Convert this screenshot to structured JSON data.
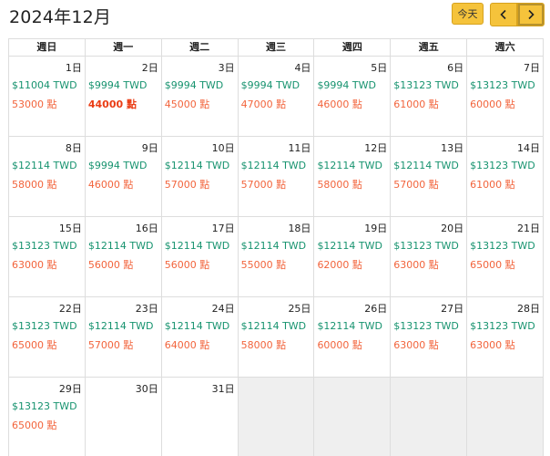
{
  "header": {
    "title": "2024年12月",
    "today_label": "今天"
  },
  "weekdays": [
    "週日",
    "週一",
    "週二",
    "週三",
    "週四",
    "週五",
    "週六"
  ],
  "weeks": [
    [
      {
        "day": "1日",
        "price": "$11004 TWD",
        "points": "53000 點"
      },
      {
        "day": "2日",
        "price": "$9994 TWD",
        "points": "44000 點",
        "highlight": true
      },
      {
        "day": "3日",
        "price": "$9994 TWD",
        "points": "45000 點"
      },
      {
        "day": "4日",
        "price": "$9994 TWD",
        "points": "47000 點"
      },
      {
        "day": "5日",
        "price": "$9994 TWD",
        "points": "46000 點"
      },
      {
        "day": "6日",
        "price": "$13123 TWD",
        "points": "61000 點"
      },
      {
        "day": "7日",
        "price": "$13123 TWD",
        "points": "60000 點"
      }
    ],
    [
      {
        "day": "8日",
        "price": "$12114 TWD",
        "points": "58000 點"
      },
      {
        "day": "9日",
        "price": "$9994 TWD",
        "points": "46000 點"
      },
      {
        "day": "10日",
        "price": "$12114 TWD",
        "points": "57000 點"
      },
      {
        "day": "11日",
        "price": "$12114 TWD",
        "points": "57000 點"
      },
      {
        "day": "12日",
        "price": "$12114 TWD",
        "points": "58000 點"
      },
      {
        "day": "13日",
        "price": "$12114 TWD",
        "points": "57000 點"
      },
      {
        "day": "14日",
        "price": "$13123 TWD",
        "points": "61000 點"
      }
    ],
    [
      {
        "day": "15日",
        "price": "$13123 TWD",
        "points": "63000 點"
      },
      {
        "day": "16日",
        "price": "$12114 TWD",
        "points": "56000 點"
      },
      {
        "day": "17日",
        "price": "$12114 TWD",
        "points": "56000 點"
      },
      {
        "day": "18日",
        "price": "$12114 TWD",
        "points": "55000 點"
      },
      {
        "day": "19日",
        "price": "$12114 TWD",
        "points": "62000 點"
      },
      {
        "day": "20日",
        "price": "$13123 TWD",
        "points": "63000 點"
      },
      {
        "day": "21日",
        "price": "$13123 TWD",
        "points": "65000 點"
      }
    ],
    [
      {
        "day": "22日",
        "price": "$13123 TWD",
        "points": "65000 點"
      },
      {
        "day": "23日",
        "price": "$12114 TWD",
        "points": "57000 點"
      },
      {
        "day": "24日",
        "price": "$12114 TWD",
        "points": "64000 點"
      },
      {
        "day": "25日",
        "price": "$12114 TWD",
        "points": "58000 點"
      },
      {
        "day": "26日",
        "price": "$12114 TWD",
        "points": "60000 點"
      },
      {
        "day": "27日",
        "price": "$13123 TWD",
        "points": "63000 點"
      },
      {
        "day": "28日",
        "price": "$13123 TWD",
        "points": "63000 點"
      }
    ],
    [
      {
        "day": "29日",
        "price": "$13123 TWD",
        "points": "65000 點"
      },
      {
        "day": "30日"
      },
      {
        "day": "31日"
      },
      {
        "empty": true
      },
      {
        "empty": true
      },
      {
        "empty": true
      },
      {
        "empty": true
      }
    ]
  ],
  "colors": {
    "price": "#17936f",
    "points": "#f2643c",
    "points_highlight": "#ea3c14",
    "button": "#f5c33b",
    "empty_cell": "#efefef"
  },
  "icons": {
    "prev": "chevron-left-icon",
    "next": "chevron-right-icon"
  }
}
